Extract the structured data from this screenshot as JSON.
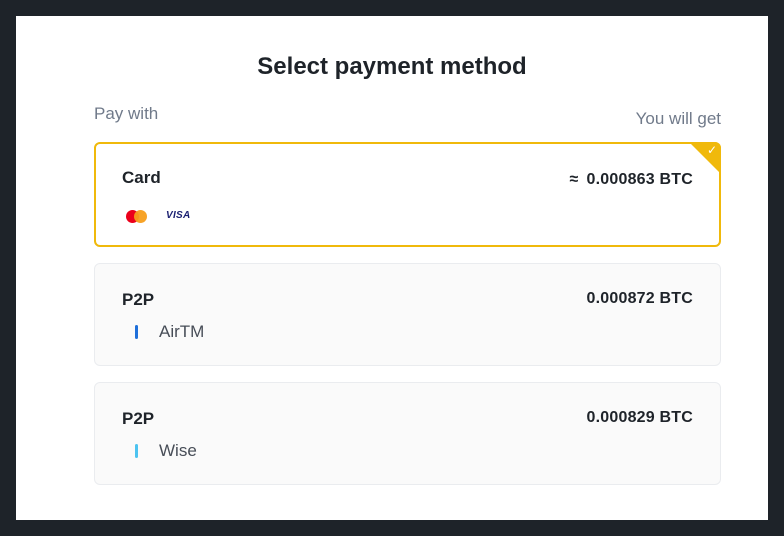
{
  "title": "Select payment method",
  "columns": {
    "left": "Pay with",
    "right": "You will get"
  },
  "options": [
    {
      "name": "Card",
      "approx": "≈",
      "amount": "0.000863 BTC",
      "selected": true,
      "brands": [
        "mastercard-icon",
        "visa"
      ],
      "visa_text": "VISA",
      "check": "✓",
      "accent": "#f0b90b"
    },
    {
      "name": "P2P",
      "amount": "0.000872 BTC",
      "selected": false,
      "sub_label": "AirTM",
      "bar_color": "#1e6fd9"
    },
    {
      "name": "P2P",
      "amount": "0.000829 BTC",
      "selected": false,
      "sub_label": "Wise",
      "bar_color": "#4cc3f0"
    }
  ]
}
